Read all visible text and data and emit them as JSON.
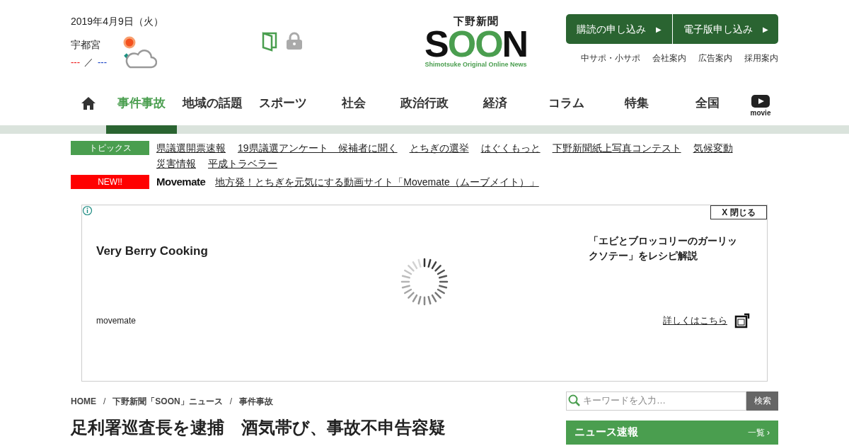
{
  "header": {
    "date": "2019年4月9日（火）",
    "city": "宇都宮",
    "temp_high": "---",
    "temp_separator": "／",
    "temp_low": "---",
    "logo": {
      "top": "下野新聞",
      "letters": [
        {
          "char": "S",
          "color": "#111111"
        },
        {
          "char": "O",
          "color": "#4a9e4f"
        },
        {
          "char": "O",
          "color": "#4a9e4f"
        },
        {
          "char": "N",
          "color": "#111111"
        }
      ],
      "tagline": "Shimotsuke Original Online News"
    },
    "cta_buttons": [
      {
        "label": "購読の申し込み",
        "arrow": "▶"
      },
      {
        "label": "電子版申し込み",
        "arrow": "▶"
      }
    ],
    "links": [
      "中サポ・小サポ",
      "会社案内",
      "広告案内",
      "採用案内"
    ]
  },
  "nav": {
    "items": [
      {
        "kind": "home",
        "selected": false
      },
      {
        "kind": "text",
        "label": "事件事故",
        "selected": true
      },
      {
        "kind": "text",
        "label": "地域の話題",
        "selected": false
      },
      {
        "kind": "text",
        "label": "スポーツ",
        "selected": false
      },
      {
        "kind": "text",
        "label": "社会",
        "selected": false
      },
      {
        "kind": "text",
        "label": "政治行政",
        "selected": false
      },
      {
        "kind": "text",
        "label": "経済",
        "selected": false
      },
      {
        "kind": "text",
        "label": "コラム",
        "selected": false
      },
      {
        "kind": "text",
        "label": "特集",
        "selected": false
      },
      {
        "kind": "text",
        "label": "全国",
        "selected": false
      },
      {
        "kind": "movie",
        "label": "movie",
        "selected": false
      }
    ]
  },
  "topics": {
    "badge": "トピックス",
    "links": [
      "県議選開票速報",
      "19県議選アンケート　候補者に聞く",
      "とちぎの選挙",
      "はぐくもっと",
      "下野新聞紙上写真コンテスト",
      "気候変動",
      "災害情報",
      "平成トラベラー"
    ]
  },
  "new_row": {
    "badge": "NEW!!",
    "brand": "Movemate",
    "link": "地方発！とちぎを元気にする動画サイト「Movemate（ムーブメイト）」"
  },
  "ad": {
    "close": "X 閉じる",
    "title": "Very Berry Cooking",
    "caption": "「エビとブロッコリーのガーリックソテー」をレシピ解説",
    "source": "movemate",
    "more": "詳しくはこちら"
  },
  "breadcrumb": [
    "HOME",
    "下野新聞「SOON」ニュース",
    "事件事故"
  ],
  "breadcrumb_separator": "/",
  "search": {
    "placeholder": "キーワードを入力…",
    "button": "検索"
  },
  "headline": "足利署巡査長を逮捕　酒気帯び、事故不申告容疑",
  "news_box": {
    "title": "ニュース速報",
    "more": "一覧 ›"
  }
}
